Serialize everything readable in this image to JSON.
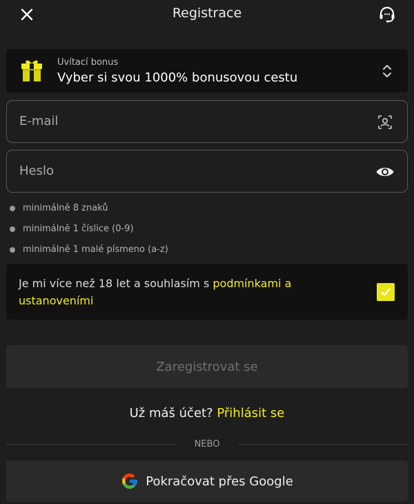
{
  "header": {
    "title": "Registrace",
    "close_icon": "close-icon",
    "support_icon": "headset-icon"
  },
  "bonus": {
    "label": "Uvítací bonus",
    "value": "Vyber si svou 1000% bonusovou cestu",
    "icon": "gift-icon"
  },
  "email": {
    "placeholder": "E-mail",
    "icon": "contact-icon"
  },
  "password": {
    "placeholder": "Heslo",
    "icon": "eye-icon"
  },
  "rules": [
    {
      "text": "minimálně 8 znaků"
    },
    {
      "text": "minimálně 1 číslice (0-9)"
    },
    {
      "text": "minimálně 1 malé písmeno (a-z)"
    }
  ],
  "terms": {
    "text": "Je mi více než 18 let a souhlasím s ",
    "link": "podmínkami a ustanoveními",
    "checked": true
  },
  "register_button": "Zaregistrovat se",
  "login": {
    "prompt": "Už máš účet?",
    "link": "Přihlásit se"
  },
  "or_label": "NEBO",
  "google_button": "Pokračovat přes Google",
  "colors": {
    "background": "#1e1e1e",
    "accent": "#f3ee1f",
    "box": "#111111",
    "button_disabled": "#2a2a2a"
  }
}
